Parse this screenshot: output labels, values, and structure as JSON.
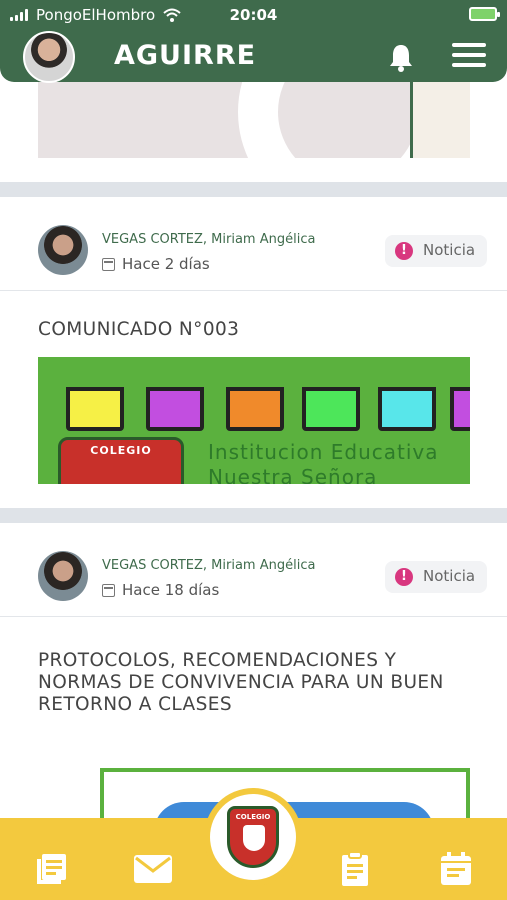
{
  "status_bar": {
    "carrier": "PongoElHombro",
    "time": "20:04"
  },
  "header": {
    "title": "AGUIRRE",
    "icons": [
      "avatar",
      "bell-icon",
      "menu-icon"
    ]
  },
  "posts": [
    {
      "author": "VEGAS CORTEZ, Miriam Angélica",
      "date": "Hace 2 días",
      "badge": "Noticia",
      "title": "COMUNICADO N°003",
      "banner_text": "Institucion Educativa",
      "banner_text_2": "Nuestra Señora",
      "crest_text": "COLEGIO"
    },
    {
      "author": "VEGAS CORTEZ, Miriam Angélica",
      "date": "Hace 18 días",
      "badge": "Noticia",
      "title": "PROTOCOLOS, RECOMENDACIONES Y NORMAS DE CONVIVENCIA PARA UN BUEN RETORNO A CLASES"
    }
  ],
  "bottom_nav": {
    "items": [
      "news-icon",
      "mail-icon",
      "school-logo",
      "clipboard-icon",
      "calendar-icon"
    ],
    "logo_text": "COLEGIO"
  },
  "colors": {
    "header_green": "#3f6b4c",
    "nav_yellow": "#f3c93e",
    "badge_pink": "#d8377f",
    "banner_green": "#5bb13e"
  }
}
